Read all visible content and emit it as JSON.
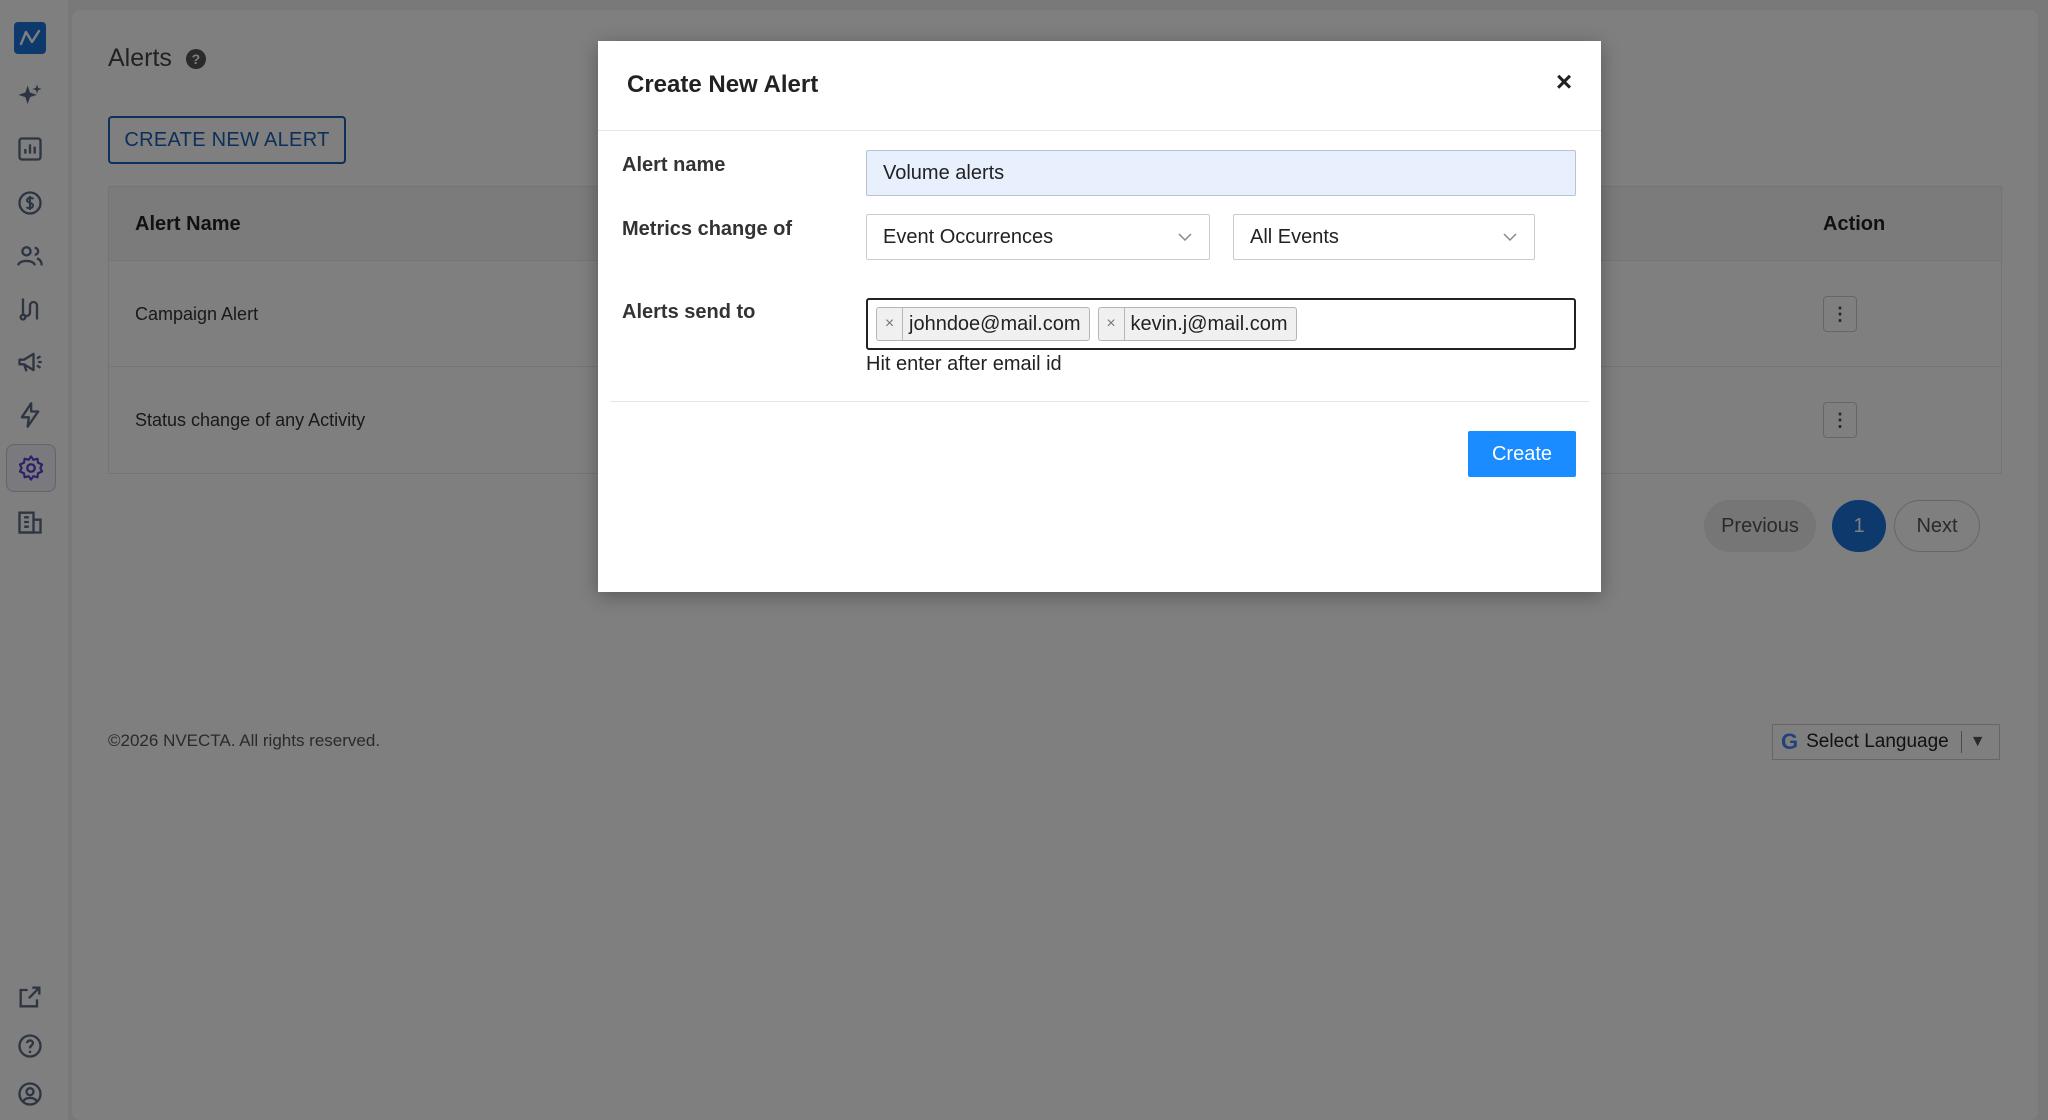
{
  "page": {
    "title": "Alerts",
    "help_icon": "question-circle-icon",
    "create_button": "CREATE NEW ALERT"
  },
  "table": {
    "headers": {
      "name": "Alert Name",
      "action": "Action"
    },
    "rows": [
      {
        "name": "Campaign Alert"
      },
      {
        "name": "Status change of any Activity"
      }
    ]
  },
  "pagination": {
    "previous": "Previous",
    "current": "1",
    "next": "Next"
  },
  "footer": {
    "copyright": "©2026 NVECTA. All rights reserved.",
    "language": "Select Language",
    "language_caret": "▼"
  },
  "modal": {
    "title": "Create New Alert",
    "close": "×",
    "fields": {
      "name_label": "Alert name",
      "name_value": "Volume alerts",
      "metrics_label": "Metrics change of",
      "metric_select": "Event Occurrences",
      "events_select": "All Events",
      "send_label": "Alerts send to",
      "recipients": [
        "johndoe@mail.com",
        "kevin.j@mail.com"
      ],
      "hint": "Hit enter after email id"
    },
    "create_button": "Create"
  },
  "colors": {
    "accent": "#1a73d9",
    "create_button": "#1a8cff",
    "outline_button": "#1a5fb4"
  }
}
